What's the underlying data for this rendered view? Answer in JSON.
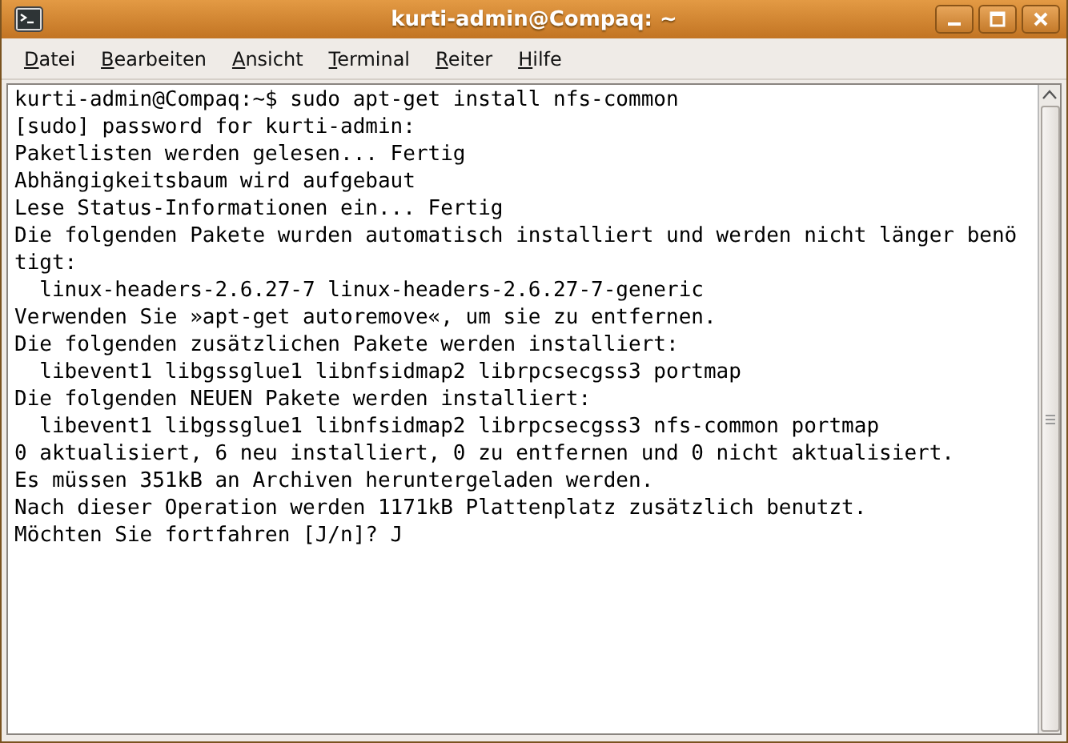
{
  "window": {
    "title": "kurti-admin@Compaq: ~"
  },
  "menu": [
    "Datei",
    "Bearbeiten",
    "Ansicht",
    "Terminal",
    "Reiter",
    "Hilfe"
  ],
  "terminal": {
    "lines": [
      "kurti-admin@Compaq:~$ sudo apt-get install nfs-common",
      "[sudo] password for kurti-admin:",
      "Paketlisten werden gelesen... Fertig",
      "Abhängigkeitsbaum wird aufgebaut",
      "Lese Status-Informationen ein... Fertig",
      "Die folgenden Pakete wurden automatisch installiert und werden nicht länger benö",
      "tigt:",
      "  linux-headers-2.6.27-7 linux-headers-2.6.27-7-generic",
      "Verwenden Sie »apt-get autoremove«, um sie zu entfernen.",
      "Die folgenden zusätzlichen Pakete werden installiert:",
      "  libevent1 libgssglue1 libnfsidmap2 librpcsecgss3 portmap",
      "Die folgenden NEUEN Pakete werden installiert:",
      "  libevent1 libgssglue1 libnfsidmap2 librpcsecgss3 nfs-common portmap",
      "0 aktualisiert, 6 neu installiert, 0 zu entfernen und 0 nicht aktualisiert.",
      "Es müssen 351kB an Archiven heruntergeladen werden.",
      "Nach dieser Operation werden 1171kB Plattenplatz zusätzlich benutzt.",
      "Möchten Sie fortfahren [J/n]? J"
    ]
  }
}
